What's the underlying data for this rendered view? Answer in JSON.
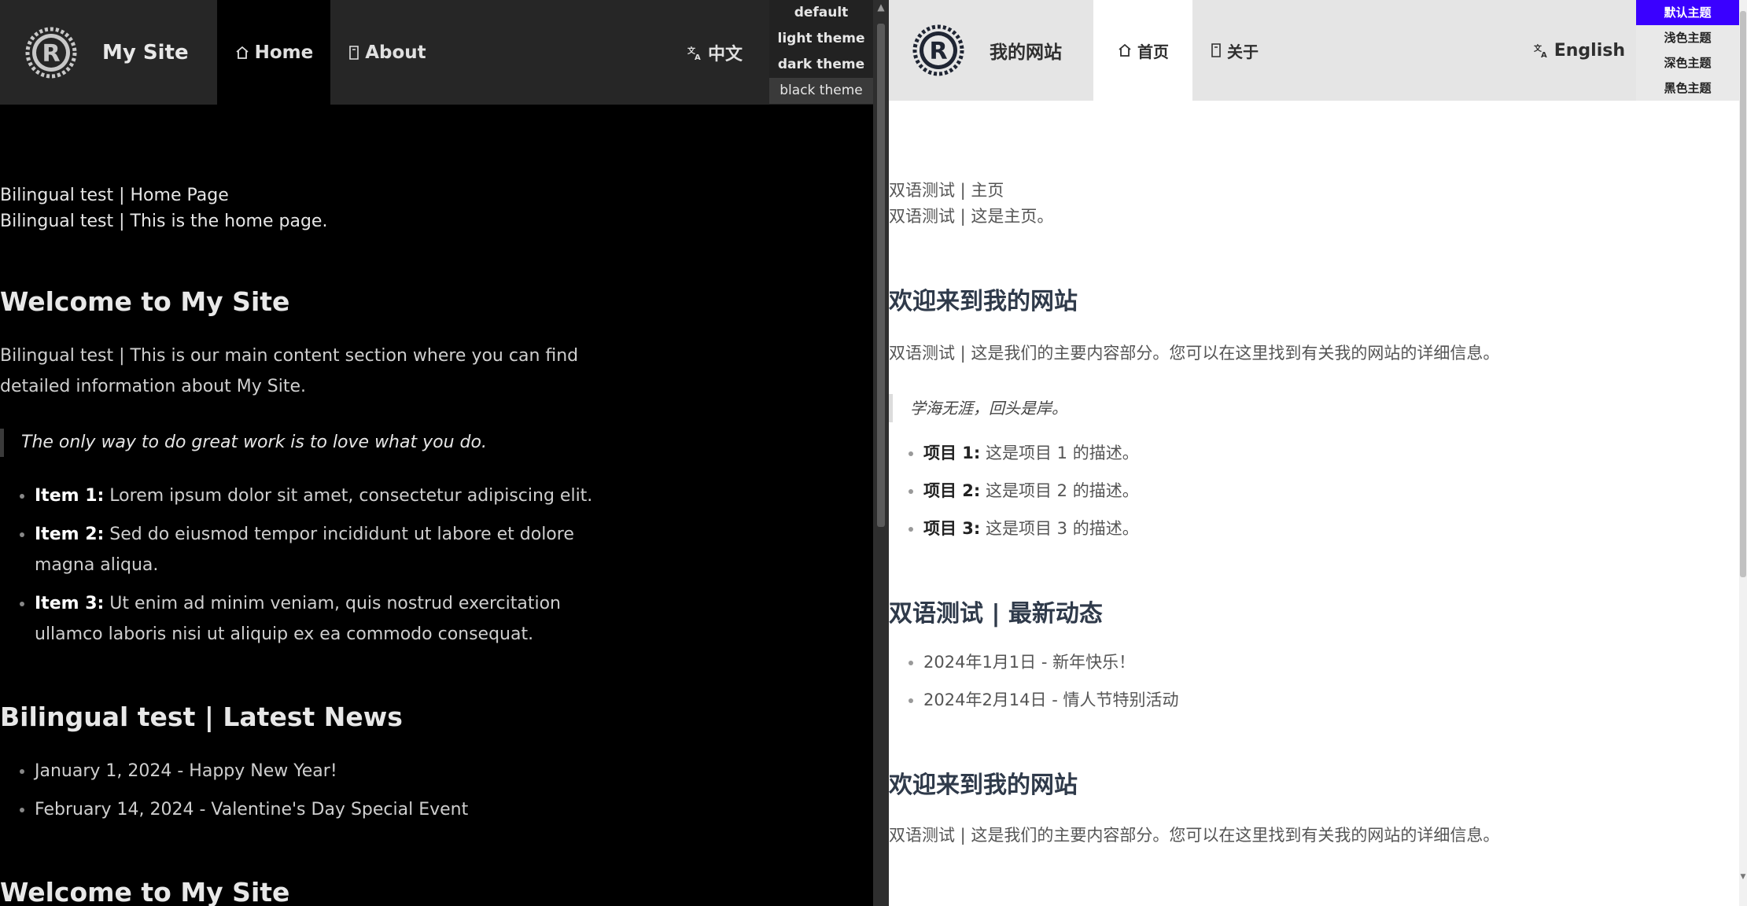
{
  "left": {
    "header": {
      "site_title": "My Site",
      "nav": [
        {
          "label": "Home",
          "icon": "home-icon"
        },
        {
          "label": "About",
          "icon": "book-icon"
        }
      ],
      "language_label": "中文",
      "theme_options": [
        "default",
        "light theme",
        "dark theme",
        "black theme"
      ]
    },
    "content": {
      "intro_line1": "Bilingual test | Home Page",
      "intro_line2": "Bilingual test | This is the home page.",
      "welcome_heading": "Welcome to My Site",
      "welcome_para": "Bilingual test | This is our main content section where you can find detailed information about My Site.",
      "quote": "The only way to do great work is to love what you do.",
      "items": [
        {
          "label": "Item 1:",
          "text": " Lorem ipsum dolor sit amet, consectetur adipiscing elit."
        },
        {
          "label": "Item 2:",
          "text": " Sed do eiusmod tempor incididunt ut labore et dolore magna aliqua."
        },
        {
          "label": "Item 3:",
          "text": " Ut enim ad minim veniam, quis nostrud exercitation ullamco laboris nisi ut aliquip ex ea commodo consequat."
        }
      ],
      "news_heading": "Bilingual test | Latest News",
      "news": [
        "January 1, 2024 - Happy New Year!",
        "February 14, 2024 - Valentine's Day Special Event"
      ],
      "welcome_heading_2": "Welcome to My Site"
    }
  },
  "right": {
    "header": {
      "site_title": "我的网站",
      "nav": [
        {
          "label": "首页",
          "icon": "home-icon"
        },
        {
          "label": "关于",
          "icon": "book-icon"
        }
      ],
      "language_label": "English",
      "theme_options": [
        "默认主题",
        "浅色主题",
        "深色主题",
        "黑色主题"
      ]
    },
    "content": {
      "intro_line1": "双语测试 | 主页",
      "intro_line2": "双语测试 | 这是主页。",
      "welcome_heading": "欢迎来到我的网站",
      "welcome_para": "双语测试 | 这是我们的主要内容部分。您可以在这里找到有关我的网站的详细信息。",
      "quote": "学海无涯，回头是岸。",
      "items": [
        {
          "label": "项目 1:",
          "text": " 这是项目 1 的描述。"
        },
        {
          "label": "项目 2:",
          "text": " 这是项目 2 的描述。"
        },
        {
          "label": "项目 3:",
          "text": " 这是项目 3 的描述。"
        }
      ],
      "news_heading": "双语测试 | 最新动态",
      "news": [
        "2024年1月1日 - 新年快乐！",
        "2024年2月14日 - 情人节特别活动"
      ],
      "welcome_heading_2": "欢迎来到我的网站",
      "welcome_para_2": "双语测试 | 这是我们的主要内容部分。您可以在这里找到有关我的网站的详细信息。"
    }
  },
  "colors": {
    "dark_bg": "#000000",
    "dark_header": "#262626",
    "light_header": "#e5e5e5",
    "selected_theme": "#3a00ff"
  }
}
